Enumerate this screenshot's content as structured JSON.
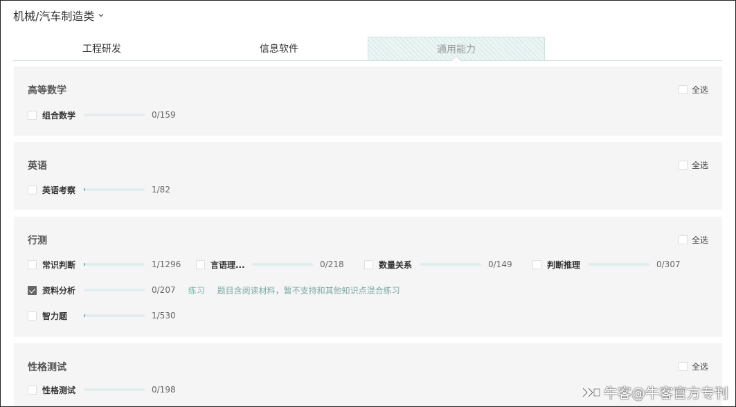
{
  "header": {
    "category": "机械/汽车制造类"
  },
  "tabs": [
    {
      "label": "工程研发",
      "active": false
    },
    {
      "label": "信息软件",
      "active": false
    },
    {
      "label": "通用能力",
      "active": true
    }
  ],
  "sections": [
    {
      "title": "高等数学",
      "select_all": "全选",
      "items": [
        {
          "name": "组合数学",
          "count": "0/159",
          "progress": 0.0,
          "checked": false
        }
      ]
    },
    {
      "title": "英语",
      "select_all": "全选",
      "items": [
        {
          "name": "英语考察",
          "count": "1/82",
          "progress": 0.012,
          "checked": false
        }
      ]
    },
    {
      "title": "行测",
      "select_all": "全选",
      "items": [
        {
          "name": "常识判断",
          "count": "1/1296",
          "progress": 0.001,
          "checked": false
        },
        {
          "name": "言语理...",
          "count": "0/218",
          "progress": 0.0,
          "checked": false
        },
        {
          "name": "数量关系",
          "count": "0/149",
          "progress": 0.0,
          "checked": false
        },
        {
          "name": "判断推理",
          "count": "0/307",
          "progress": 0.0,
          "checked": false
        },
        {
          "name": "资料分析",
          "count": "0/207",
          "progress": 0.0,
          "checked": true,
          "practice": "练习",
          "note": "题目含阅读材料，暂不支持和其他知识点混合练习"
        },
        {
          "name": "智力题",
          "count": "1/530",
          "progress": 0.002,
          "checked": false
        }
      ]
    },
    {
      "title": "性格测试",
      "select_all": "全选",
      "items": [
        {
          "name": "性格测试",
          "count": "0/198",
          "progress": 0.0,
          "checked": false
        }
      ]
    }
  ],
  "watermark": {
    "text": "牛客@牛客官方专刊",
    "icon": "nowcoder-logo-icon"
  },
  "colors": {
    "accent": "#67b7ae",
    "bar_track": "#e1eeed",
    "section_bg": "#f5f5f5",
    "tab_active_bg": "#eaf5f4"
  }
}
